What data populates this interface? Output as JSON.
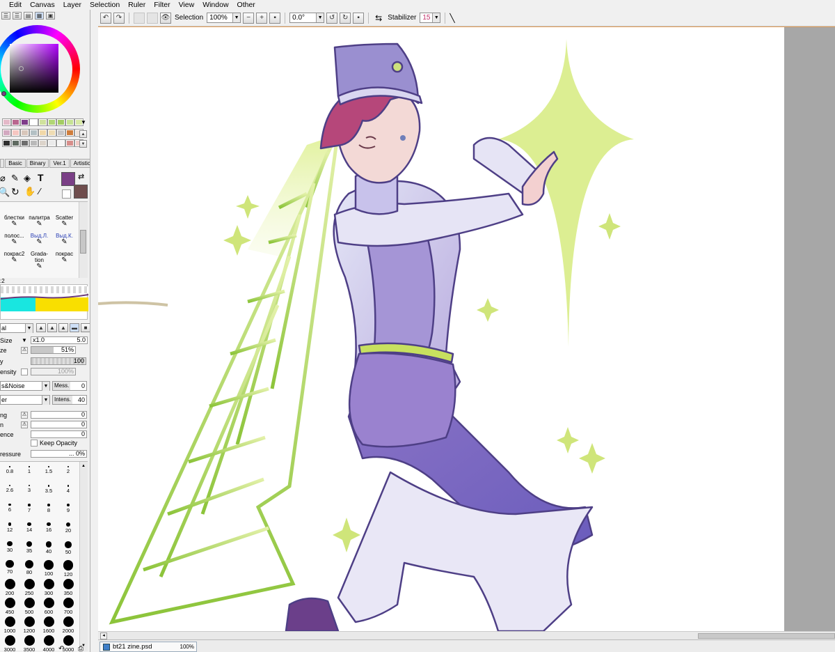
{
  "menu": [
    "Edit",
    "Canvas",
    "Layer",
    "Selection",
    "Ruler",
    "Filter",
    "View",
    "Window",
    "Other"
  ],
  "toolbar": {
    "selection_label": "Selection",
    "zoom_value": "100%",
    "rotation_value": "0.0°",
    "stabilizer_label": "Stabilizer",
    "stabilizer_value": "15"
  },
  "colors": {
    "accent": "#7a3f86",
    "secondary": "#6f4d4d",
    "palette_row1": [
      "#e4b9c8",
      "#b9678f",
      "#7e3c8a",
      "#ffffff",
      "#d0e29d",
      "#b1d675",
      "#a3cc64",
      "#c6e294",
      "#d8e9a6"
    ],
    "palette_row2": [
      "#d3a9c0",
      "#f6c6c1",
      "#d8c6ba",
      "#b3c0c4",
      "#f1d8a8",
      "#efdcb3",
      "#c7c6c7",
      "#cf7d3c",
      "#ede0d8"
    ],
    "palette_row3": [
      "#2f2f2f",
      "#5f6a61",
      "#6e6e6e",
      "#b9b9b9",
      "#dcd4cb",
      "#eaeaea",
      "#f5f5f5",
      "#d78e8b",
      "#f0cac7"
    ]
  },
  "brush_tabs": [
    "Basic",
    "Binary",
    "Ver.1",
    "Artistic"
  ],
  "brushes": [
    [
      "блестки",
      "палитра",
      "Scatter"
    ],
    [
      "полос...",
      "Выд.Л.",
      "Выд.К."
    ],
    [
      "покрас2",
      "Grada-tion",
      "покрас"
    ]
  ],
  "brush_blend_mode": "al",
  "brush_settings": {
    "size_label": "Size",
    "size_multiplier": "x1.0",
    "size_value": "5.0",
    "min_size_label": "ze",
    "min_size_value": "51%",
    "density_label": "y",
    "density_value": "100",
    "intensity_label": "ensity",
    "intensity_value": "100%",
    "texture_name": "s&Noise",
    "texture_param": "Mess.",
    "texture_value": "0",
    "paper_name": "er",
    "paper_param": "Intens.",
    "paper_value": "40",
    "blending_label": "ng",
    "blending_value": "0",
    "dilution_label": "n",
    "dilution_value": "0",
    "persistence_label": "ence",
    "persistence_value": "0",
    "keep_opacity_label": "Keep Opacity",
    "pressure_label": "ressure",
    "pressure_value": "... 0%"
  },
  "brush_sizes": [
    "0.8",
    "1",
    "1.5",
    "2",
    "2.6",
    "3",
    "3.5",
    "4",
    "6",
    "7",
    "8",
    "9",
    "12",
    "14",
    "16",
    "20",
    "30",
    "35",
    "40",
    "50",
    "70",
    "80",
    "100",
    "120",
    "200",
    "250",
    "300",
    "350",
    "450",
    "500",
    "600",
    "700",
    "1000",
    "1200",
    "1600",
    "2000",
    "3000",
    "3500",
    "4000",
    "5000"
  ],
  "document": {
    "tab_name": "bt21 zine.psd",
    "tab_zoom": "100%"
  }
}
